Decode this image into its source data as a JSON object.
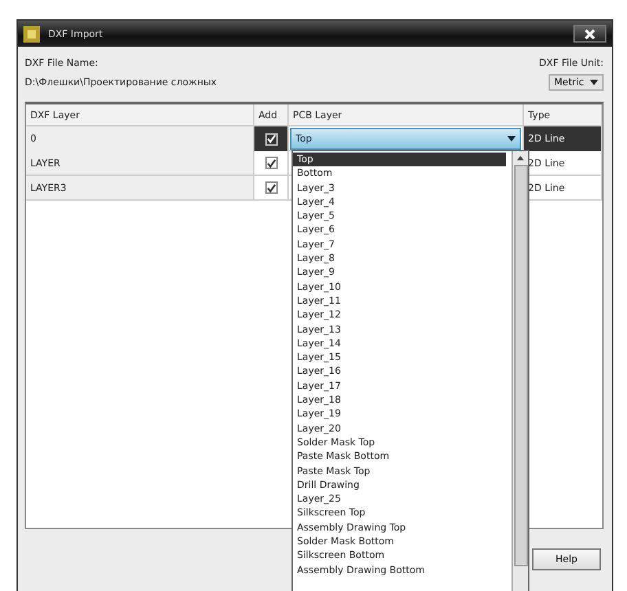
{
  "window": {
    "title": "DXF Import"
  },
  "file_name": {
    "label": "DXF File Name:",
    "value": "D:\\Флешки\\Проектирование сложных"
  },
  "file_unit": {
    "label": "DXF File Unit:",
    "value": "Metric"
  },
  "table": {
    "columns": [
      "DXF Layer",
      "Add",
      "PCB Layer",
      "Type"
    ],
    "rows": [
      {
        "dxf_layer": "0",
        "add": true,
        "pcb_layer": "Top",
        "type": "2D Line",
        "selected": true
      },
      {
        "dxf_layer": "LAYER",
        "add": true,
        "pcb_layer": "",
        "type": "2D Line",
        "selected": false
      },
      {
        "dxf_layer": "LAYER3",
        "add": true,
        "pcb_layer": "",
        "type": "2D Line",
        "selected": false
      }
    ]
  },
  "dropdown": {
    "items": [
      {
        "label": "Top",
        "selected": true
      },
      {
        "label": "Bottom",
        "selected": false
      },
      {
        "label": "Layer_3",
        "selected": false
      },
      {
        "label": "Layer_4",
        "selected": false
      },
      {
        "label": "Layer_5",
        "selected": false
      },
      {
        "label": "Layer_6",
        "selected": false
      },
      {
        "label": "Layer_7",
        "selected": false
      },
      {
        "label": "Layer_8",
        "selected": false
      },
      {
        "label": "Layer_9",
        "selected": false
      },
      {
        "label": "Layer_10",
        "selected": false
      },
      {
        "label": "Layer_11",
        "selected": false
      },
      {
        "label": "Layer_12",
        "selected": false
      },
      {
        "label": "Layer_13",
        "selected": false
      },
      {
        "label": "Layer_14",
        "selected": false
      },
      {
        "label": "Layer_15",
        "selected": false
      },
      {
        "label": "Layer_16",
        "selected": false
      },
      {
        "label": "Layer_17",
        "selected": false
      },
      {
        "label": "Layer_18",
        "selected": false
      },
      {
        "label": "Layer_19",
        "selected": false
      },
      {
        "label": "Layer_20",
        "selected": false
      },
      {
        "label": "Solder Mask Top",
        "selected": false
      },
      {
        "label": "Paste Mask Bottom",
        "selected": false
      },
      {
        "label": "Paste Mask Top",
        "selected": false
      },
      {
        "label": "Drill Drawing",
        "selected": false
      },
      {
        "label": "Layer_25",
        "selected": false
      },
      {
        "label": "Silkscreen Top",
        "selected": false
      },
      {
        "label": "Assembly Drawing Top",
        "selected": false
      },
      {
        "label": "Solder Mask Bottom",
        "selected": false
      },
      {
        "label": "Silkscreen Bottom",
        "selected": false
      },
      {
        "label": "Assembly Drawing Bottom",
        "selected": false
      }
    ]
  },
  "buttons": [
    {
      "label": "Help"
    }
  ]
}
